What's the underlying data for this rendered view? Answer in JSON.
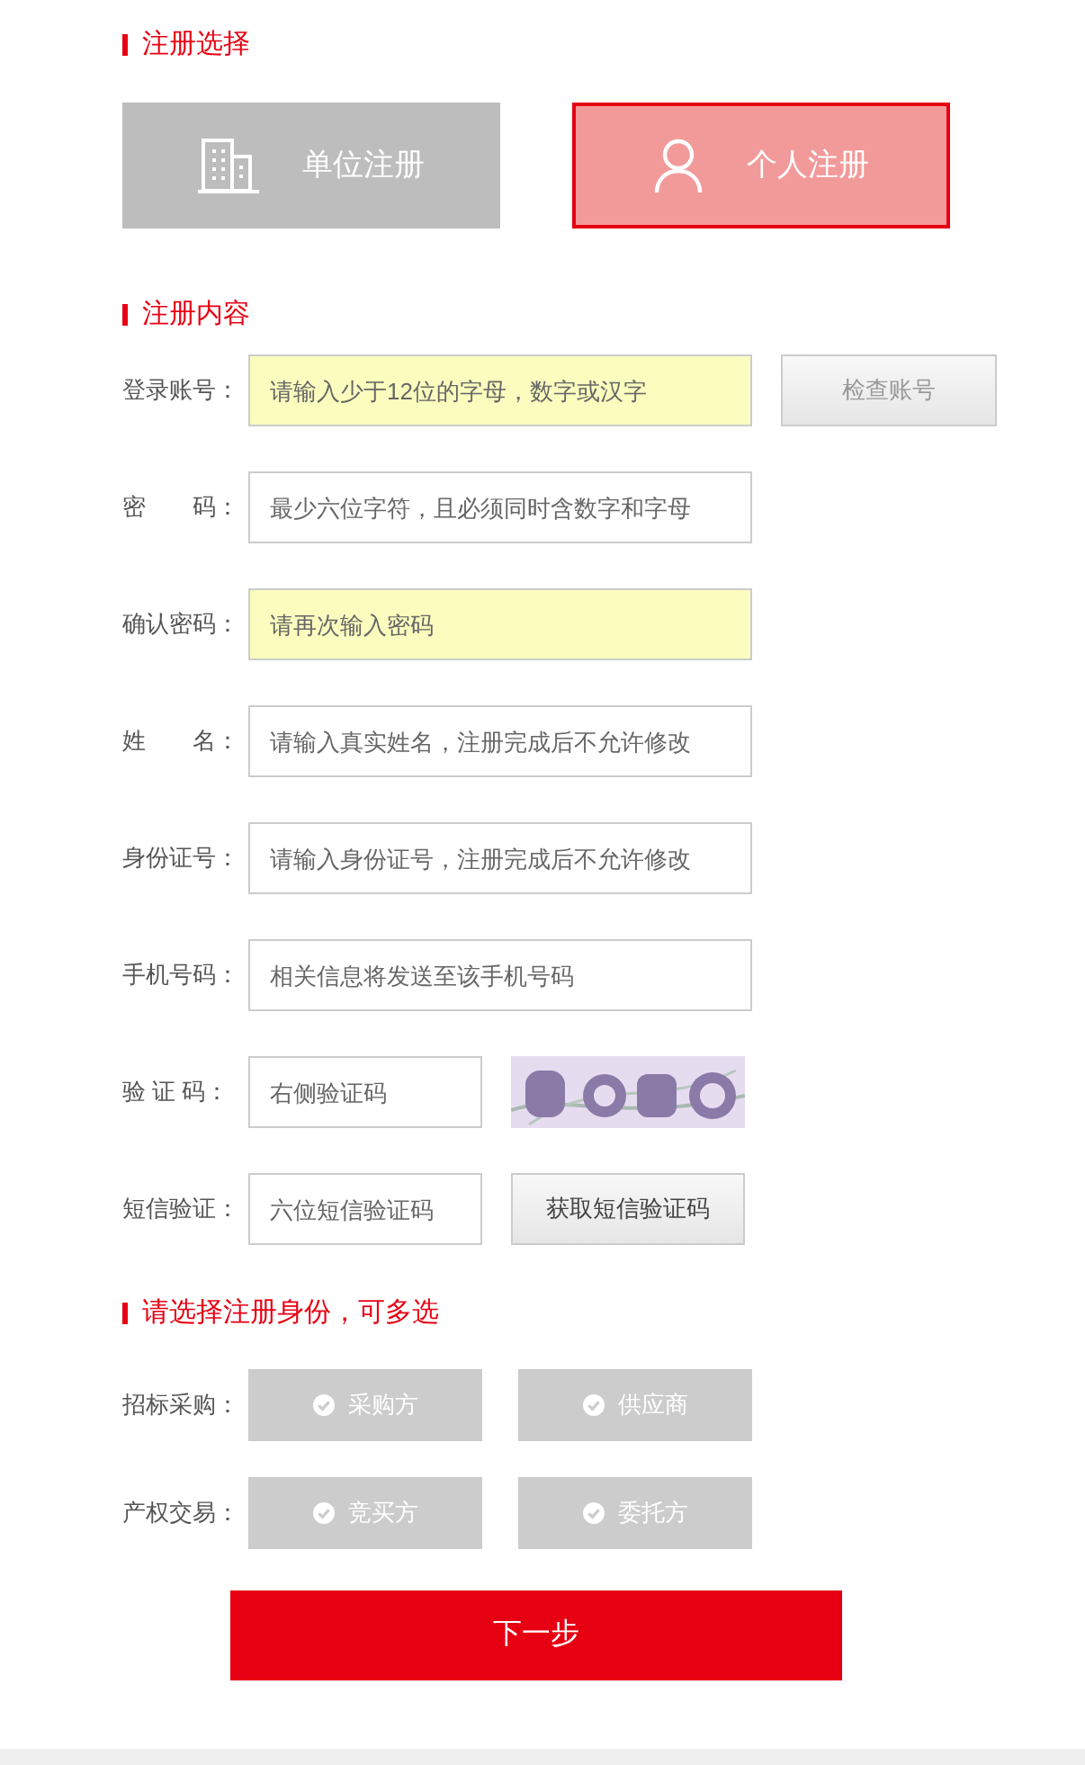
{
  "registration_type": {
    "title": "注册选择",
    "options": [
      {
        "label": "单位注册",
        "kind": "organization",
        "selected": false
      },
      {
        "label": "个人注册",
        "kind": "person",
        "selected": true
      }
    ]
  },
  "registration_form": {
    "title": "注册内容",
    "fields": [
      {
        "label": "登录账号：",
        "placeholder": "请输入少于12位的字母，数字或汉字",
        "highlighted": true,
        "kind": "button",
        "button": {
          "label": "检查账号",
          "disabled": true
        }
      },
      {
        "label": "密　　码：",
        "placeholder": "最少六位字符，且必须同时含数字和字母",
        "highlighted": false,
        "kind": "wide"
      },
      {
        "label": "确认密码：",
        "placeholder": "请再次输入密码",
        "highlighted": true,
        "kind": "wide"
      },
      {
        "label": "姓　　名：",
        "placeholder": "请输入真实姓名，注册完成后不允许修改",
        "highlighted": false,
        "kind": "wide"
      },
      {
        "label": "身份证号：",
        "placeholder": "请输入身份证号，注册完成后不允许修改",
        "highlighted": false,
        "kind": "wide"
      },
      {
        "label": "手机号码：",
        "placeholder": "相关信息将发送至该手机号码",
        "highlighted": false,
        "kind": "wide"
      },
      {
        "label": "验 证 码：",
        "placeholder": "右侧验证码",
        "highlighted": false,
        "kind": "captcha"
      },
      {
        "label": "短信验证：",
        "placeholder": "六位短信验证码",
        "highlighted": false,
        "kind": "button",
        "button": {
          "label": "获取短信验证码",
          "disabled": false
        }
      }
    ]
  },
  "roles": {
    "title": "请选择注册身份，可多选",
    "groups": [
      {
        "label": "招标采购：",
        "options": [
          {
            "label": "采购方",
            "selected": false
          },
          {
            "label": "供应商",
            "selected": false
          }
        ]
      },
      {
        "label": "产权交易：",
        "options": [
          {
            "label": "竞买方",
            "selected": false
          },
          {
            "label": "委托方",
            "selected": false
          }
        ]
      }
    ]
  },
  "next_button": "下一步"
}
